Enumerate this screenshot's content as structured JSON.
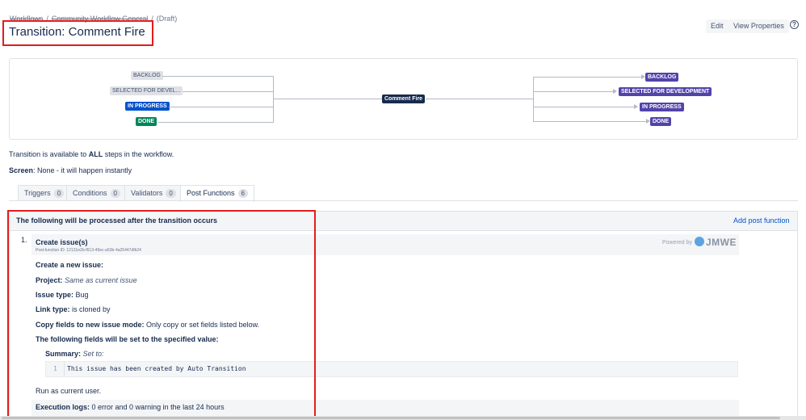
{
  "breadcrumb": {
    "items": [
      "Workflows",
      "Community Workflow General"
    ],
    "separator": "/",
    "status": "(Draft)"
  },
  "title": "Transition: Comment Fire",
  "header_buttons": {
    "edit": "Edit",
    "view_properties": "View Properties",
    "help": "?"
  },
  "diagram": {
    "from_statuses": [
      {
        "label": "BACKLOG",
        "color": "gray"
      },
      {
        "label": "SELECTED FOR DEVEL...",
        "color": "gray"
      },
      {
        "label": "IN PROGRESS",
        "color": "blue"
      },
      {
        "label": "DONE",
        "color": "green"
      }
    ],
    "transition": "Comment Fire",
    "to_statuses": [
      {
        "label": "BACKLOG"
      },
      {
        "label": "SELECTED FOR DEVELOPMENT"
      },
      {
        "label": "IN PROGRESS"
      },
      {
        "label": "DONE"
      }
    ]
  },
  "availability": {
    "prefix": "Transition is available to ",
    "bold": "ALL",
    "suffix": " steps in the workflow."
  },
  "screen": {
    "label": "Screen",
    "value": ": None - it will happen instantly"
  },
  "tabs": [
    {
      "label": "Triggers",
      "count": "0"
    },
    {
      "label": "Conditions",
      "count": "0"
    },
    {
      "label": "Validators",
      "count": "0"
    },
    {
      "label": "Post Functions",
      "count": "6"
    }
  ],
  "panel": {
    "title": "The following will be processed after the transition occurs",
    "add_link": "Add post function"
  },
  "post_function": {
    "number": "1.",
    "title": "Create issue(s)",
    "id_text": "Post-function ID: 12131e2b-f613-49ec-a53b-4a25447dfb24",
    "powered_by": "Powered by",
    "brand": "JMWE",
    "create_new": "Create a new issue:",
    "project_label": "Project:",
    "project_value": "Same as current issue",
    "issue_type_label": "Issue type:",
    "issue_type_value": "Bug",
    "link_type_label": "Link type:",
    "link_type_value": "is cloned by",
    "copy_mode_label": "Copy fields to new issue mode:",
    "copy_mode_value": "Only copy or set fields listed below.",
    "fields_heading": "The following fields will be set to the specified value:",
    "summary_label": "Summary:",
    "summary_mode": "Set to:",
    "code_line_no": "1",
    "code_text": "This issue has been created by Auto Transition",
    "run_as": "Run as current user.",
    "exec_label": "Execution logs:",
    "exec_value": "0 error and 0 warning in the last 24 hours"
  },
  "colors": {
    "highlight_red": "#e41c1c",
    "status_blue": "#0052cc",
    "status_green": "#00875a",
    "status_purple": "#5243aa",
    "link_blue": "#0052cc"
  }
}
